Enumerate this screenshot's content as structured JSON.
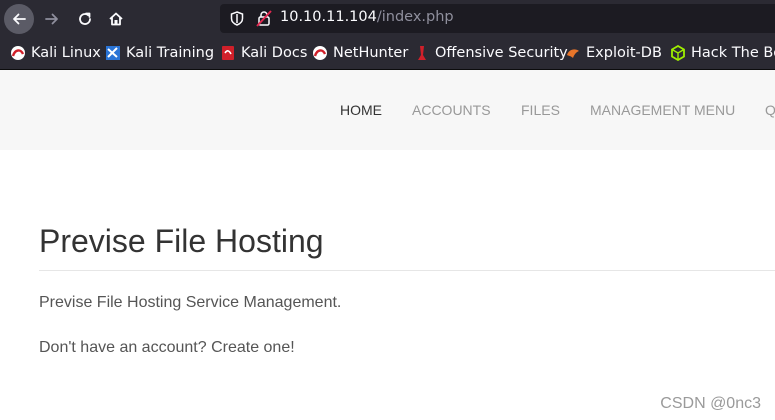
{
  "browser": {
    "url_host": "10.10.11.104",
    "url_path": "/index.php"
  },
  "bookmarks": [
    {
      "label": "Kali Linux",
      "icon": "kali-linux-icon"
    },
    {
      "label": "Kali Training",
      "icon": "kali-training-icon"
    },
    {
      "label": "Kali Docs",
      "icon": "kali-docs-icon"
    },
    {
      "label": "NetHunter",
      "icon": "nethunter-icon"
    },
    {
      "label": "Offensive Security",
      "icon": "offensive-security-icon"
    },
    {
      "label": "Exploit-DB",
      "icon": "exploit-db-icon"
    },
    {
      "label": "Hack The Bo",
      "icon": "hack-the-box-icon"
    }
  ],
  "nav": {
    "home": "HOME",
    "accounts": "ACCOUNTS",
    "files": "FILES",
    "management_menu": "MANAGEMENT MENU",
    "truncated": "Q"
  },
  "main": {
    "title": "Previse File Hosting",
    "subtitle": "Previse File Hosting Service Management.",
    "account_prompt": "Don't have an account? Create one!"
  },
  "watermark": "CSDN @0nc3",
  "colors": {
    "toolbar_bg": "#2b2a33",
    "url_bg": "#1c1b22",
    "nav_bg": "#f7f7f7",
    "nav_active": "#333333",
    "nav_inactive": "#999999",
    "text": "#555555"
  }
}
